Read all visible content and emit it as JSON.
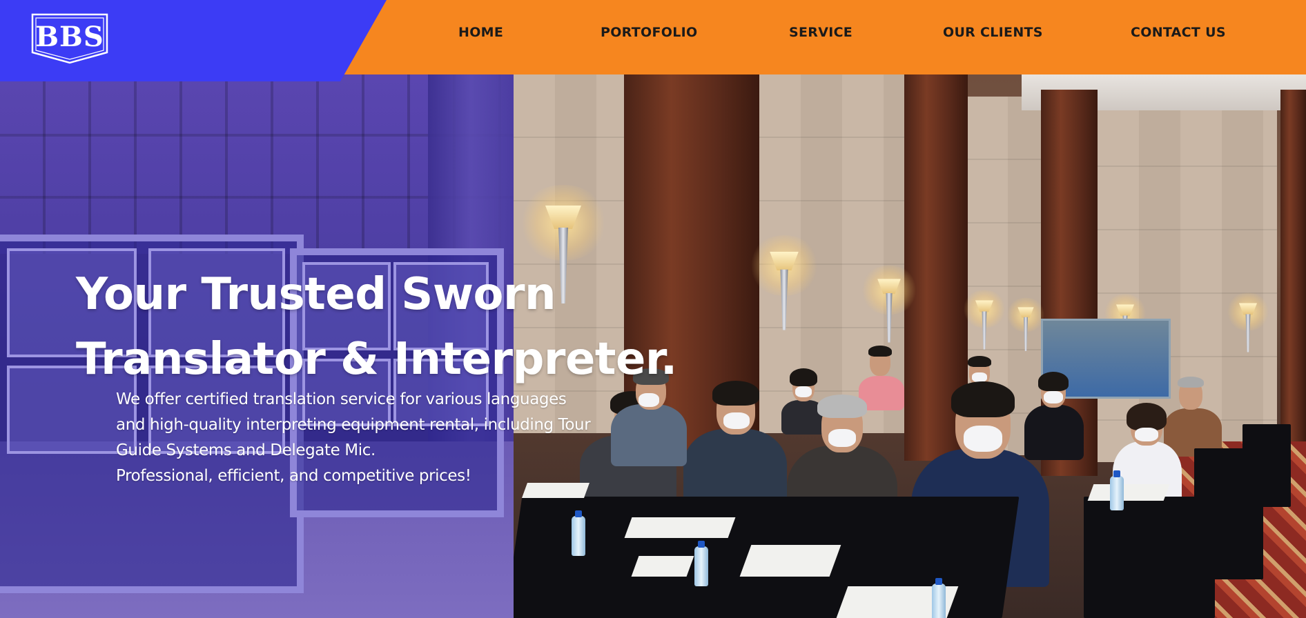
{
  "brand": {
    "logo_text": "BBS",
    "colors": {
      "blue": "#3c3cf5",
      "orange": "#f6861f",
      "nav_text": "#1a1a1a",
      "hero_text": "#ffffff"
    }
  },
  "nav": {
    "items": [
      {
        "label": "HOME"
      },
      {
        "label": "PORTOFOLIO"
      },
      {
        "label": "SERVICE"
      },
      {
        "label": "OUR CLIENTS"
      },
      {
        "label": "CONTACT US"
      }
    ]
  },
  "hero": {
    "headline_line1": "Your Trusted Sworn",
    "headline_line2": "Translator & Interpreter.",
    "sub_line1": "We offer certified translation service for various languages",
    "sub_line2": "and high-quality interpreting equipment rental, including Tour",
    "sub_line3": "Guide Systems and Delegate Mic.",
    "sub_line4": "Professional, efficient, and competitive prices!",
    "background_image": "conference-room-interpreting-photo"
  }
}
